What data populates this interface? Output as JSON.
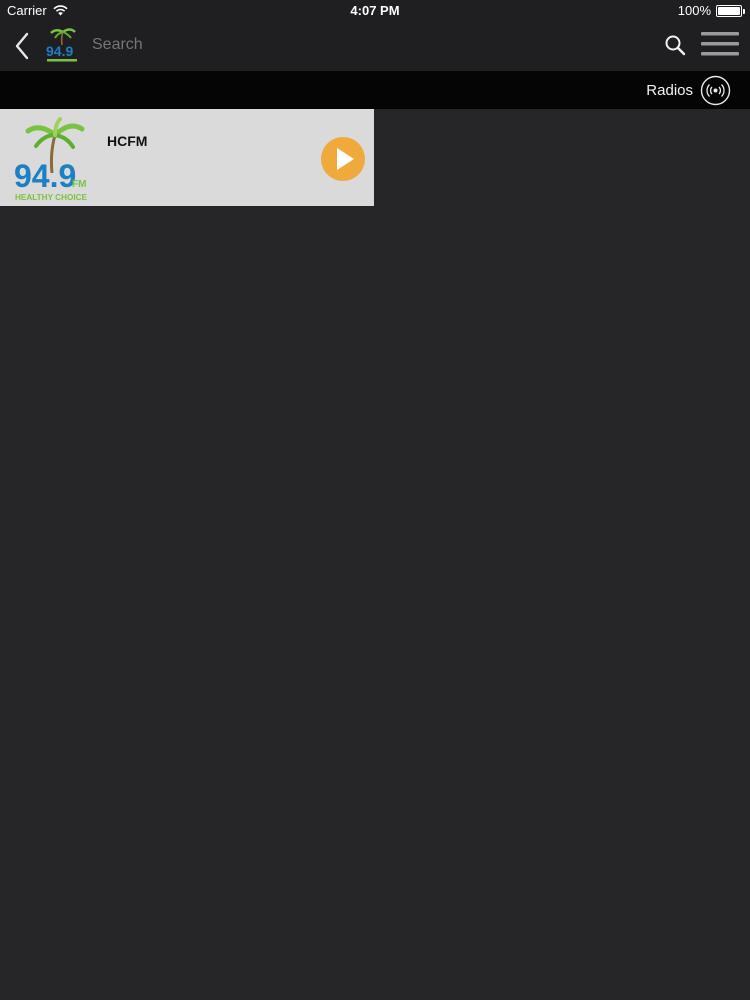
{
  "status_bar": {
    "carrier": "Carrier",
    "time": "4:07 PM",
    "battery": "100%",
    "battery_level": 1.0
  },
  "nav_bar": {
    "back_icon": "chevron-left-icon",
    "search_placeholder": "Search",
    "search_icon": "search-icon",
    "menu_icon": "hamburger-menu-icon"
  },
  "sub_header": {
    "label": "Radios",
    "icon": "radio-broadcast-icon"
  },
  "stations": [
    {
      "name": "HCFM",
      "logo_text": "94.9",
      "logo_suffix": "FM",
      "logo_tagline": "HEALTHY CHOICE"
    }
  ],
  "colors": {
    "background": "#262527",
    "bar": "#1f1e20",
    "sub_header": "#050505",
    "card": "#dadada",
    "play": "#f0a93b",
    "logo_blue": "#1d7fc4",
    "logo_green": "#7cc242"
  }
}
